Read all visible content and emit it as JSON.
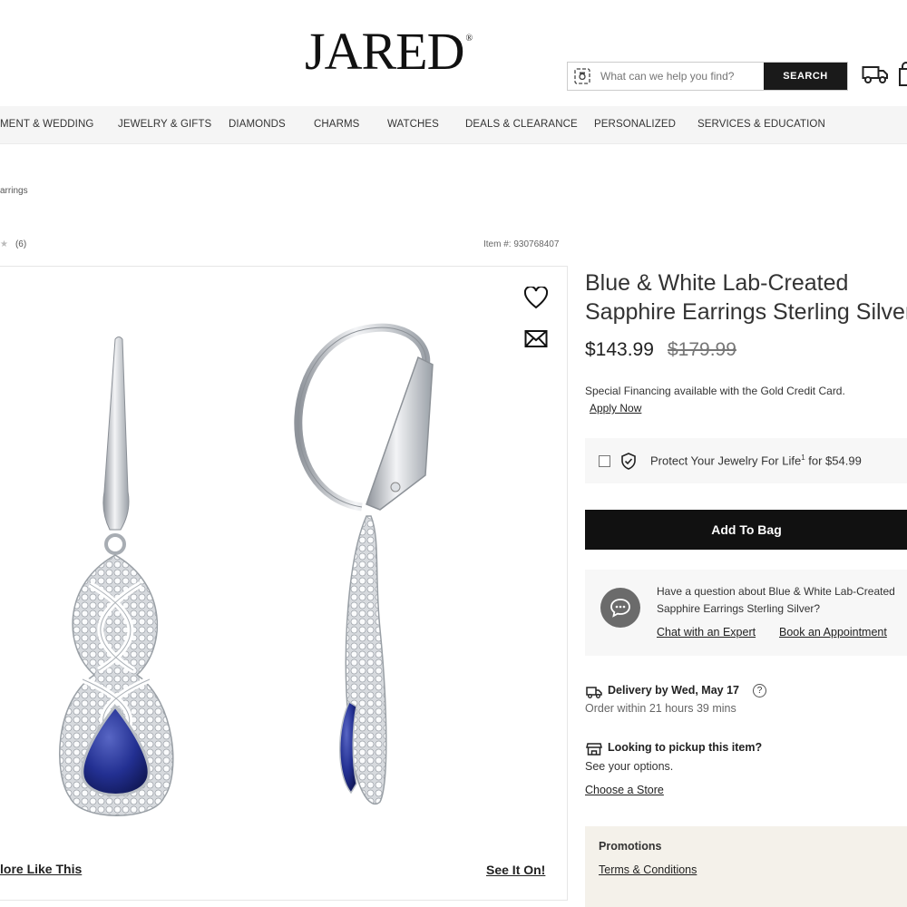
{
  "header": {
    "logo": "JARED",
    "logo_mark": "®",
    "search_placeholder": "What can we help you find?",
    "search_button": "SEARCH"
  },
  "nav": {
    "items": [
      "MENT & WEDDING",
      "JEWELRY & GIFTS",
      "DIAMONDS",
      "CHARMS",
      "WATCHES",
      "DEALS & CLEARANCE",
      "PERSONALIZED",
      "SERVICES & EDUCATION"
    ]
  },
  "breadcrumb": "arrings",
  "rating": {
    "count": "(6)"
  },
  "item_number": "Item #: 930768407",
  "gallery": {
    "more_like": "lore Like This",
    "see_it_on": "See It On!"
  },
  "product": {
    "title_line1": "Blue & White Lab-Created",
    "title_line2": "Sapphire Earrings Sterling Silver",
    "price": "$143.99",
    "original_price": "$179.99",
    "financing": "Special Financing available with the Gold Credit Card.",
    "apply_now": "Apply Now",
    "protect_label": "Protect Your Jewelry For Life",
    "protect_sup": "1",
    "protect_price": " for $54.99",
    "add_to_bag": "Add To Bag"
  },
  "expert": {
    "question": "Have a question about Blue & White Lab-Created Sapphire Earrings Sterling Silver?",
    "chat": "Chat with an Expert",
    "appointment": "Book an Appointment"
  },
  "delivery": {
    "title": "Delivery by Wed, May 17",
    "help": "?",
    "order_within": "Order within 21 hours 39 mins"
  },
  "pickup": {
    "title": "Looking to pickup this item?",
    "see_options": "See your options.",
    "choose_store": "Choose a Store"
  },
  "promotions": {
    "title": "Promotions",
    "terms": "Terms & Conditions"
  },
  "colors": {
    "black": "#111111",
    "sapphire": "#1f2a78",
    "silver": "#c9ccd1"
  }
}
